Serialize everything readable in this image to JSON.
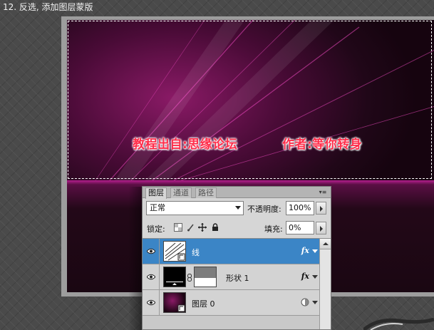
{
  "step": {
    "title": "12. 反选, 添加图层蒙版"
  },
  "canvas": {
    "watermark_left": "教程出自:思缘论坛",
    "watermark_right": "作者:等你转身",
    "colors": {
      "magenta": "#b51e8e",
      "dark": "#1c0513",
      "watermark": "#ff2d4a"
    }
  },
  "layers_panel": {
    "tabs": [
      {
        "label": "图层",
        "active": true
      },
      {
        "label": "通道",
        "active": false
      },
      {
        "label": "路径",
        "active": false
      }
    ],
    "menu_icon": "panel-menu-icon",
    "blend_mode": "正常",
    "opacity_label": "不透明度:",
    "opacity_value": "100%",
    "lock_label": "锁定:",
    "fill_label": "填充:",
    "fill_value": "0%",
    "lock_icons": [
      "lock-transparent-icon",
      "lock-brush-icon",
      "lock-move-icon",
      "lock-all-icon"
    ],
    "layers": [
      {
        "name": "线",
        "selected": true,
        "has_fx": true,
        "fx_label": "fx"
      },
      {
        "name": "形状 1",
        "selected": false,
        "has_fx": true,
        "fx_label": "fx"
      },
      {
        "name": "图层 0",
        "selected": false,
        "has_fx": false
      }
    ],
    "selected_color": "#3b85c6"
  }
}
